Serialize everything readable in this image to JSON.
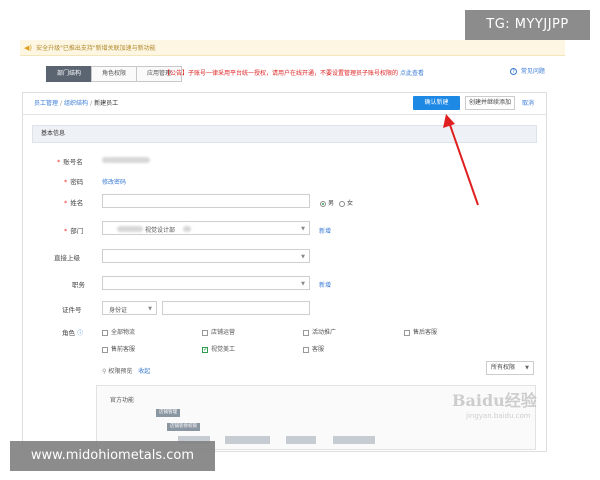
{
  "notice": {
    "text": "安全升级\"已推出支持\"新增关联加速与新功能"
  },
  "tabs": [
    "部门结构",
    "角色权限",
    "应用管理"
  ],
  "tab_notice": {
    "text": "【公告】子账号一律采用平台统一授权，请用户在线开通，不要设置管理员子账号权限的",
    "link": "点此查看"
  },
  "help": "常见问题",
  "breadcrumb": {
    "items": [
      "员工管理",
      "组织结构"
    ],
    "current": "新建员工"
  },
  "actions": {
    "confirm": "确认新建",
    "save_continue": "创建并继续添加",
    "cancel": "取消"
  },
  "section_title": "基本信息",
  "form": {
    "account_label": "账号名",
    "password_label": "密码",
    "password_link": "修改密码",
    "name_label": "姓名",
    "gender_male": "男",
    "gender_female": "女",
    "dept_label": "部门",
    "dept_value": "视觉设计部",
    "dept_link": "新增",
    "superior_label": "直接上级",
    "position_label": "职务",
    "position_link": "新增",
    "id_label": "证件号",
    "id_type": "身份证",
    "role_label": "角色"
  },
  "roles": [
    {
      "label": "全部物流",
      "checked": false
    },
    {
      "label": "店铺运营",
      "checked": false
    },
    {
      "label": "活动推广",
      "checked": false
    },
    {
      "label": "售后客服",
      "checked": false
    },
    {
      "label": "售前客服",
      "checked": false
    },
    {
      "label": "视觉美工",
      "checked": true
    },
    {
      "label": "客服",
      "checked": false
    }
  ],
  "permissions": {
    "label": "权限预览",
    "toggle": "收起",
    "select": "所有权限",
    "title": "官方功能"
  },
  "tree_nodes": [
    "店铺管理",
    "店铺装修权限"
  ],
  "overlay": {
    "tag_tr": "TG: MYYJJPP",
    "tag_bl": "www.midohiometals.com",
    "watermark": "Baidu经验",
    "watermark_sub": "jingyan.baidu.com"
  }
}
